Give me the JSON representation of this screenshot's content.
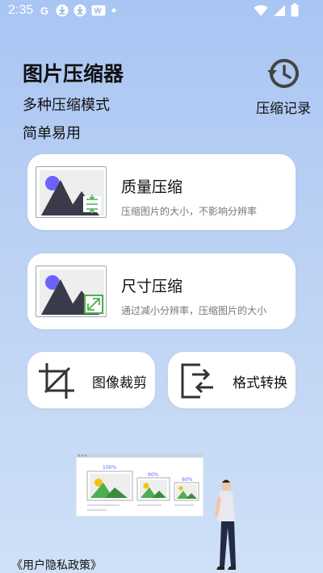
{
  "status_bar": {
    "time": "2:35",
    "icons": [
      "google-icon",
      "download-icon",
      "download-icon",
      "notification-icon",
      "dot-icon"
    ],
    "right_icons": [
      "wifi-icon",
      "signal-icon",
      "battery-icon"
    ]
  },
  "header": {
    "title": "图片压缩器",
    "subtitle1": "多种压缩模式",
    "subtitle2": "简单易用"
  },
  "history": {
    "label": "压缩记录",
    "icon": "history-icon"
  },
  "cards": [
    {
      "title": "质量压缩",
      "desc": "压缩图片的大小，不影响分辨率"
    },
    {
      "title": "尺寸压缩",
      "desc": "通过减小分辨率，压缩图片的大小"
    }
  ],
  "tools": [
    {
      "label": "图像裁剪",
      "icon": "crop-icon"
    },
    {
      "label": "格式转换",
      "icon": "convert-icon"
    }
  ],
  "illustration": {
    "labels": [
      "100%",
      "90%",
      "60%"
    ]
  },
  "footer": {
    "privacy": "《用户隐私政策》"
  },
  "colors": {
    "accent_green": "#4caf50",
    "mountain": "#3b3a4a",
    "sun": "#6c63ff",
    "card_bg": "#ffffff"
  }
}
